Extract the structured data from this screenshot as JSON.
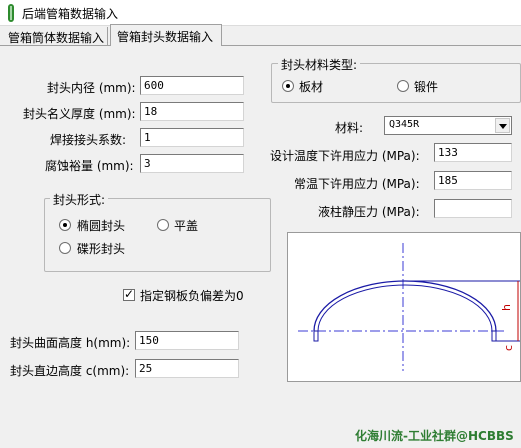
{
  "window": {
    "title": "后端管箱数据输入"
  },
  "tabs": [
    {
      "label": "管箱筒体数据输入"
    },
    {
      "label": "管箱封头数据输入"
    }
  ],
  "left": {
    "head_inner_diameter": {
      "label": "封头内径 (mm):",
      "value": "600"
    },
    "head_nominal_thickness": {
      "label": "封头名义厚度 (mm):",
      "value": "18"
    },
    "weld_joint_coefficient": {
      "label": "焊接接头系数:",
      "value": "1"
    },
    "corrosion_allowance": {
      "label": "腐蚀裕量 (mm):",
      "value": "3"
    },
    "head_form": {
      "legend": "封头形式:",
      "options": [
        {
          "label": "椭圆封头",
          "selected": true
        },
        {
          "label": "平盖",
          "selected": false
        },
        {
          "label": "碟形封头",
          "selected": false
        }
      ]
    },
    "plate_negative_deviation": {
      "label": "指定钢板负偏差为0",
      "checked": true,
      "check_glyph": "✓"
    },
    "head_curved_height": {
      "label": "封头曲面高度 h(mm):",
      "value": "150"
    },
    "head_straight_height": {
      "label": "封头直边高度 c(mm):",
      "value": "25"
    }
  },
  "right": {
    "material_type": {
      "legend": "封头材料类型:",
      "options": [
        {
          "label": "板材",
          "selected": true
        },
        {
          "label": "锻件",
          "selected": false
        }
      ]
    },
    "material": {
      "label": "材料:",
      "value": "Q345R"
    },
    "allowable_stress_design_temp": {
      "label": "设计温度下许用应力 (MPa):",
      "value": "133"
    },
    "allowable_stress_room_temp": {
      "label": "常温下许用应力 (MPa):",
      "value": "185"
    },
    "liquid_column_pressure": {
      "label": "液柱静压力 (MPa):",
      "value": ""
    },
    "diagram": {
      "label_h": "h",
      "label_c": "c"
    }
  },
  "footer": {
    "watermark": "化海川流-工业社群@HCBBS"
  },
  "colors": {
    "diagram_line": "#1a1aa6",
    "dashdot": "#3b3bd4",
    "dimension": "#c00000",
    "watermark": "#2e7d32"
  }
}
